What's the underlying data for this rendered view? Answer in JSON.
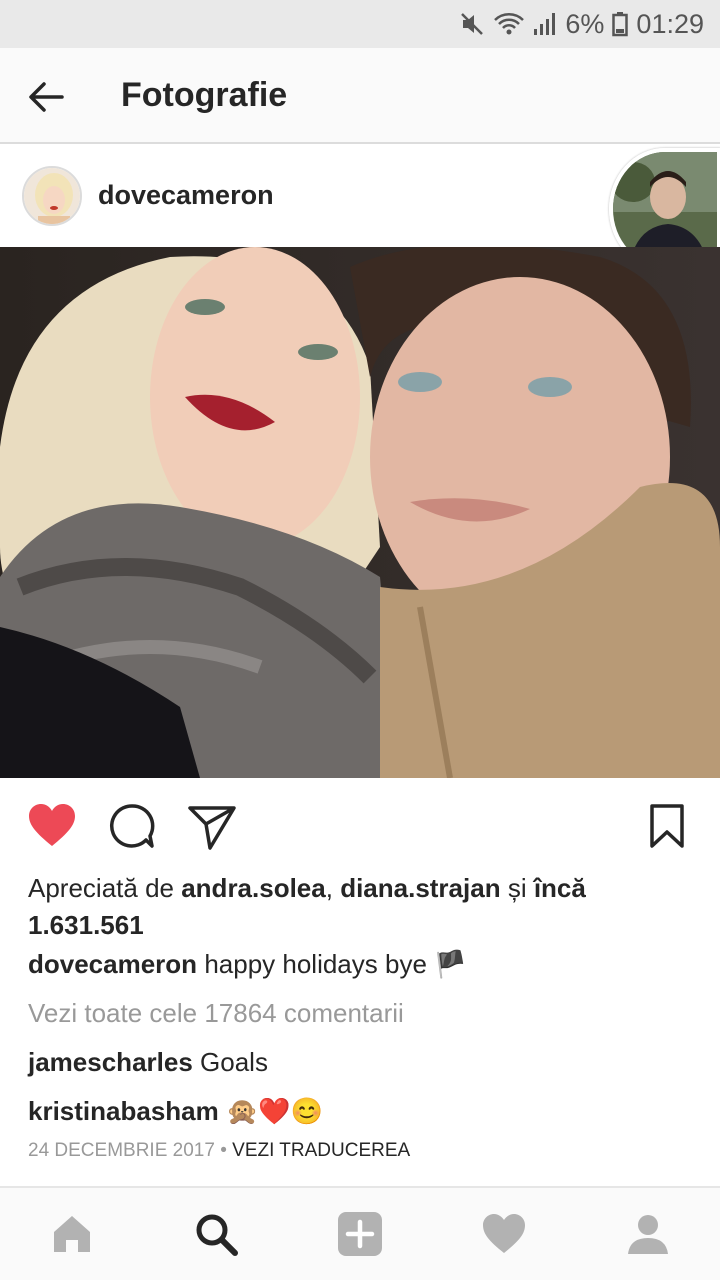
{
  "status_bar": {
    "battery": "6%",
    "time": "01:29",
    "icons": [
      "mute-icon",
      "wifi-icon",
      "signal-icon",
      "battery-icon"
    ]
  },
  "app_bar": {
    "title": "Fotografie",
    "back_icon": "back-arrow-icon"
  },
  "post": {
    "username": "dovecameron",
    "likes_prefix": "Apreciată de ",
    "liker_1": "andra.solea",
    "liker_sep": ", ",
    "liker_2": "diana.strajan",
    "liker_and": " și ",
    "likes_more": "încă 1.631.561",
    "caption_user": "dovecameron",
    "caption_text": "happy holidays bye 🏴",
    "view_all_comments": "Vezi toate cele 17864 comentarii",
    "comments": [
      {
        "user": "jamescharles",
        "text": "Goals"
      },
      {
        "user": "kristinabasham",
        "text": "🙊❤️😊"
      }
    ],
    "date": "24 DECEMBRIE 2017",
    "date_sep": " • ",
    "translate": "VEZI TRADUCEREA"
  },
  "colors": {
    "like_red": "#ed4956",
    "nav_gray": "#b2b2b2",
    "text": "#262626",
    "muted": "#999999"
  },
  "nav": {
    "items": [
      "home-icon",
      "search-icon",
      "add-icon",
      "heart-icon",
      "profile-icon"
    ]
  }
}
